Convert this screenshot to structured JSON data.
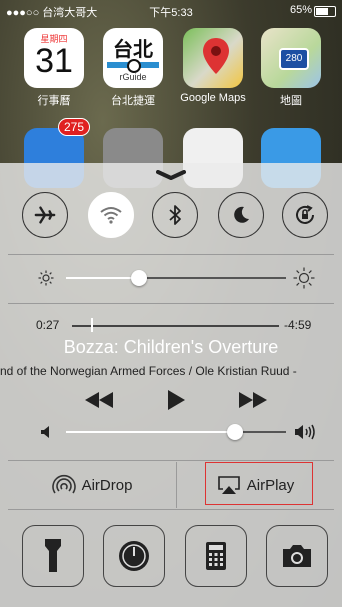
{
  "status": {
    "carrier": "●●●○○ 台湾大哥大",
    "time": "下午5:33",
    "battery": "65%"
  },
  "apps": [
    {
      "label": "行事曆",
      "day_name": "星期四",
      "day": "31"
    },
    {
      "label": "台北捷運",
      "title": "台北",
      "sub": "rGuide"
    },
    {
      "label": "Google Maps"
    },
    {
      "label": "地圖",
      "sign": "280"
    }
  ],
  "dock_badge": "275",
  "music": {
    "elapsed": "0:27",
    "remaining": "-4:59",
    "title": "Bozza: Children's Overture",
    "artist": "nd of the Norwegian Armed Forces / Ole Kristian Ruud -",
    "progress": 0.09,
    "volume": 0.77
  },
  "brightness": 0.33,
  "airdrop_label": "AirDrop",
  "airplay_label": "AirPlay",
  "colors": {
    "accent_outline": "#dd3333",
    "panel": "#ebebeb"
  }
}
